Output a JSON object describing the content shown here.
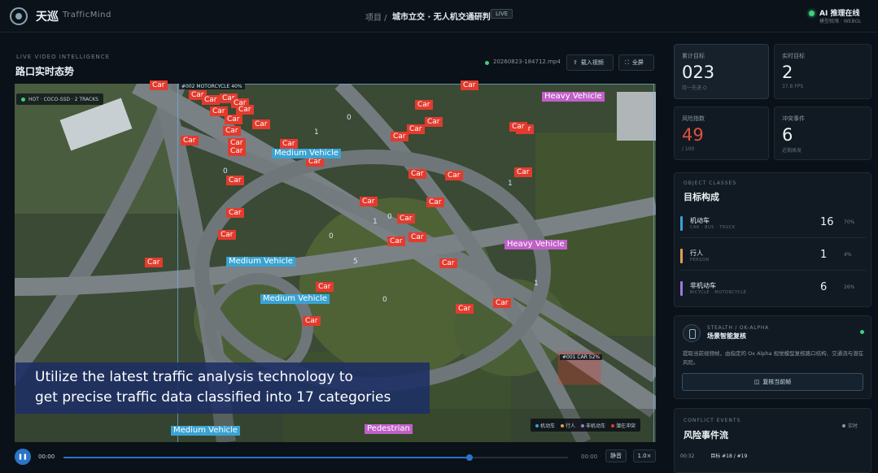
{
  "app": {
    "brand_cn": "天巡",
    "brand_en": "TrafficMind",
    "breadcrumb_root": "项目 /",
    "breadcrumb_title": "城市立交 · 无人机交通研判",
    "live_pill": "LIVE",
    "ai_status_title": "AI 推理在线",
    "ai_status_sub": "模型就绪 · WEBGL"
  },
  "main": {
    "eyebrow": "LIVE VIDEO INTELLIGENCE",
    "title": "路口实时态势",
    "file_name": "20260823-184712.mp4",
    "download_label": "载入视频",
    "fullscreen_label": "全屏",
    "hud_text": "HOT · COCO-SSD · 2 TRACKS",
    "caption_line1": "Utilize the latest traffic analysis technology to",
    "caption_line2": "get precise traffic data classified into 17 categories",
    "legend": [
      {
        "label": "机动车",
        "color": "#3aa3d2"
      },
      {
        "label": "行人",
        "color": "#e0a050"
      },
      {
        "label": "非机动车",
        "color": "#9a7ad8"
      },
      {
        "label": "潜在冲突",
        "color": "#e23b2e"
      }
    ],
    "tags": [
      {
        "kind": "car",
        "text": "Car"
      },
      {
        "kind": "car",
        "text": "Car"
      },
      {
        "kind": "car",
        "text": "Car"
      },
      {
        "kind": "car",
        "text": "Car"
      },
      {
        "kind": "car",
        "text": "Car"
      },
      {
        "kind": "car",
        "text": "Car"
      },
      {
        "kind": "car",
        "text": "Car"
      },
      {
        "kind": "car",
        "text": "Car"
      },
      {
        "kind": "car",
        "text": "Car"
      },
      {
        "kind": "car",
        "text": "Car"
      },
      {
        "kind": "car",
        "text": "Car"
      },
      {
        "kind": "car",
        "text": "Car"
      },
      {
        "kind": "car",
        "text": "Car"
      },
      {
        "kind": "car",
        "text": "Car"
      },
      {
        "kind": "car",
        "text": "Car"
      },
      {
        "kind": "car",
        "text": "Car"
      },
      {
        "kind": "car",
        "text": "Car"
      },
      {
        "kind": "car",
        "text": "Car"
      },
      {
        "kind": "car",
        "text": "Car"
      },
      {
        "kind": "car",
        "text": "Car"
      },
      {
        "kind": "car",
        "text": "Car"
      },
      {
        "kind": "car",
        "text": "Car"
      },
      {
        "kind": "car",
        "text": "Car"
      },
      {
        "kind": "car",
        "text": "Car"
      },
      {
        "kind": "car",
        "text": "Car"
      },
      {
        "kind": "car",
        "text": "Car"
      },
      {
        "kind": "car",
        "text": "Car"
      },
      {
        "kind": "car",
        "text": "Car"
      },
      {
        "kind": "car",
        "text": "Car"
      },
      {
        "kind": "car",
        "text": "Car"
      },
      {
        "kind": "car",
        "text": "Car"
      },
      {
        "kind": "car",
        "text": "Car"
      },
      {
        "kind": "car",
        "text": "Car"
      },
      {
        "kind": "car",
        "text": "Car"
      },
      {
        "kind": "car",
        "text": "Car"
      },
      {
        "kind": "car",
        "text": "Car"
      },
      {
        "kind": "car",
        "text": "Car"
      },
      {
        "kind": "car",
        "text": "Car"
      },
      {
        "kind": "car",
        "text": "Car"
      },
      {
        "kind": "heavy",
        "text": "Heavy Vehicle"
      },
      {
        "kind": "heavy",
        "text": "Heavy Vehicle"
      },
      {
        "kind": "med",
        "text": "Medium Vehicle"
      },
      {
        "kind": "med",
        "text": "Medium Vehicle"
      },
      {
        "kind": "med",
        "text": "Medium Vehicle"
      },
      {
        "kind": "med",
        "text": "Medium Vehicle"
      },
      {
        "kind": "ped",
        "text": "Pedestrian"
      }
    ],
    "box_labels": [
      "#002 MOTORCYCLE 40%",
      "#001 CAR 52%"
    ],
    "track_ids": [
      "0",
      "1",
      "0",
      "1",
      "1",
      "0",
      "0",
      "5",
      "0",
      "1"
    ]
  },
  "player": {
    "play_icon": "pause-icon",
    "current_time": "00:00",
    "end_time": "00:00",
    "mute_label": "静音",
    "speed_label": "1.0×",
    "progress": 0.8
  },
  "stats": {
    "cards": [
      {
        "label": "累计目标",
        "value": "023",
        "sub": "持一先进 O"
      },
      {
        "label": "实时目标",
        "value": "2",
        "sub": "37.8 FPS"
      },
      {
        "label": "风险指数",
        "value": "49",
        "sub": "/ 100"
      },
      {
        "label": "冲突事件",
        "value": "6",
        "sub": "近期高发"
      }
    ]
  },
  "classes": {
    "eyebrow": "OBJECT CLASSES",
    "title": "目标构成",
    "rows": [
      {
        "name": "机动车",
        "sub": "CAR · BUS · TRUCK",
        "count": "16",
        "pct": "70%",
        "color": "#3aa3d2"
      },
      {
        "name": "行人",
        "sub": "PERSON",
        "count": "1",
        "pct": "4%",
        "color": "#e0a050"
      },
      {
        "name": "非机动车",
        "sub": "BICYCLE · MOTORCYCLE",
        "count": "6",
        "pct": "26%",
        "color": "#9a7ad8"
      }
    ]
  },
  "stealth": {
    "eyebrow": "STEALTH / OK-ALPHA",
    "title": "场景智能复核",
    "desc": "提取当前视频帧，由指定的 Ox Alpha 视觉模型复核路口结构、交通流与潜在风险。",
    "button_label": "复核当前帧"
  },
  "conflict": {
    "eyebrow": "CONFLICT EVENTS",
    "title": "风险事件流",
    "live_label": "实时",
    "row_time": "00:32",
    "row_text": "目标 #18 / #19"
  }
}
